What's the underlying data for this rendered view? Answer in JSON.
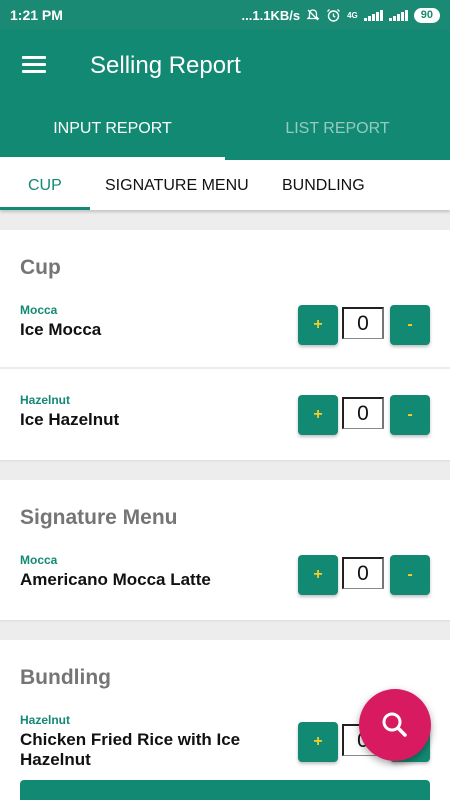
{
  "status_bar": {
    "time": "1:21 PM",
    "network_speed": "...1.1KB/s",
    "network_type": "4G",
    "battery": "90"
  },
  "app": {
    "title": "Selling Report",
    "menu_icon": "hamburger-menu-icon"
  },
  "top_tabs": [
    {
      "label": "INPUT REPORT",
      "active": true
    },
    {
      "label": "LIST REPORT",
      "active": false
    }
  ],
  "sub_tabs": [
    {
      "label": "CUP",
      "active": true
    },
    {
      "label": "SIGNATURE MENU",
      "active": false
    },
    {
      "label": "BUNDLING",
      "active": false
    }
  ],
  "sections": [
    {
      "title": "Cup",
      "items": [
        {
          "category": "Mocca",
          "name": "Ice Mocca",
          "quantity": "0"
        },
        {
          "category": "Hazelnut",
          "name": "Ice Hazelnut",
          "quantity": "0"
        }
      ]
    },
    {
      "title": "Signature Menu",
      "items": [
        {
          "category": "Mocca",
          "name": "Americano Mocca Latte",
          "quantity": "0"
        }
      ]
    },
    {
      "title": "Bundling",
      "items": [
        {
          "category": "Hazelnut",
          "name": "Chicken Fried Rice with Ice Hazelnut",
          "quantity": "0"
        }
      ]
    }
  ],
  "buttons": {
    "plus": "+",
    "minus": "-"
  },
  "fab": {
    "icon": "search-icon"
  },
  "colors": {
    "primary": "#128a73",
    "status_bar": "#1a8a74",
    "accent": "#d81b60",
    "button_text": "#f1cf2a",
    "section_title": "#757575"
  }
}
